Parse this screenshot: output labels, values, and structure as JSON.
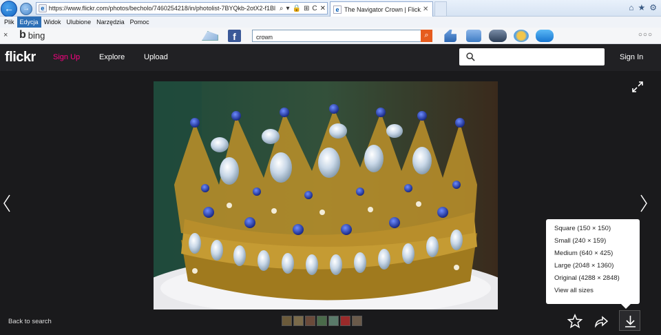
{
  "browser": {
    "url": "https://www.flickr.com/photos/becholo/7460254218/in/photolist-7BYQkb-2otX2-f1Bl",
    "tab_title": "The Navigator Crown | Flick...",
    "tab_close": "✕",
    "address_controls": [
      "⌕",
      "▾",
      "🔒",
      "⊞",
      "C",
      "✕"
    ]
  },
  "menubar": {
    "items": [
      "Plik",
      "Edycja",
      "Widok",
      "Ulubione",
      "Narzędzia",
      "Pomoc"
    ],
    "active": "Edycja"
  },
  "bing_toolbar": {
    "close": "×",
    "logo_text": "bing",
    "search_value": "crown",
    "facebook_letter": "f",
    "more": "○○○"
  },
  "flickr": {
    "logo": "flickr",
    "nav": {
      "signup": "Sign Up",
      "explore": "Explore",
      "upload": "Upload"
    },
    "search_placeholder": "",
    "signin": "Sign In",
    "accent": "#ff0084"
  },
  "viewer": {
    "back_to_search": "Back to search",
    "download_sizes": [
      "Square (150 × 150)",
      "Small (240 × 159)",
      "Medium (640 × 425)",
      "Large (2048 × 1360)",
      "Original (4288 × 2848)",
      "View all sizes"
    ],
    "thumbnail_colors": [
      "#6b5a3a",
      "#7a6a4a",
      "#6a4a3a",
      "#4a6a4a",
      "#5a7a6a",
      "#9a2a2a",
      "#6a5a4a"
    ],
    "icons": [
      "star-icon",
      "share-icon",
      "download-icon",
      "expand-icon",
      "chevron-left-icon",
      "chevron-right-icon"
    ]
  }
}
